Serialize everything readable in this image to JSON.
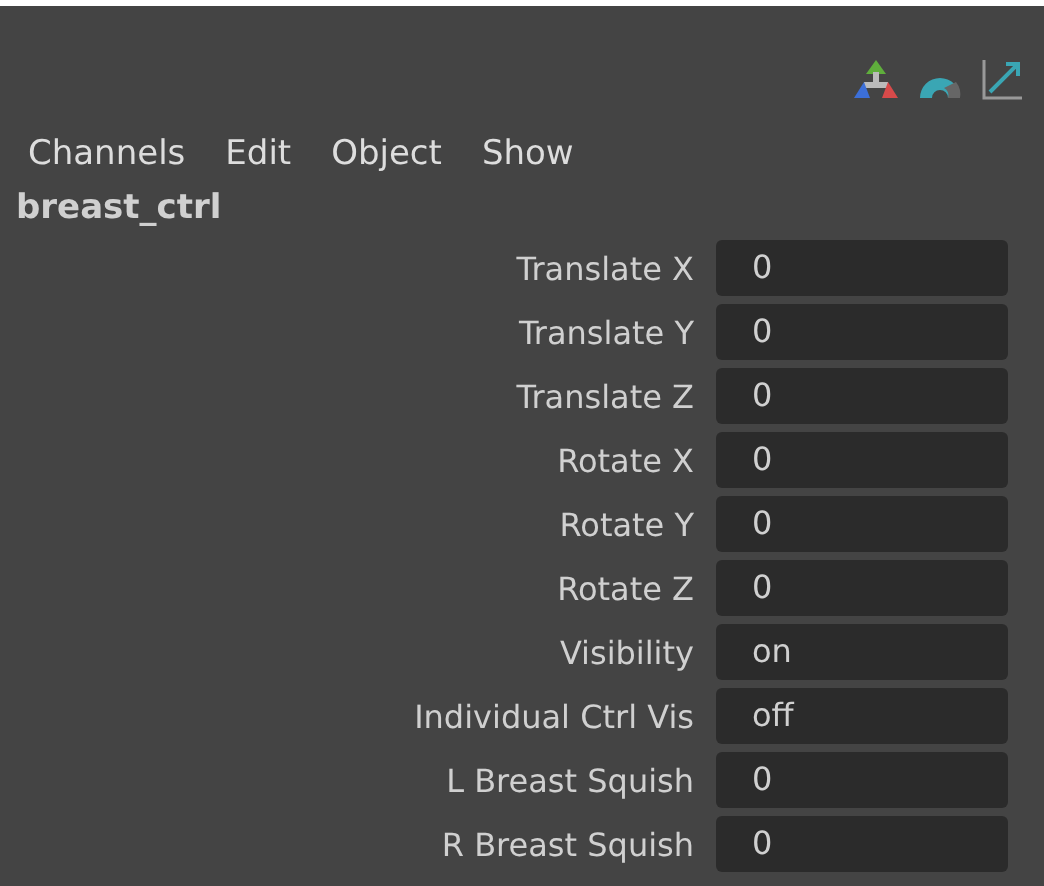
{
  "menu": [
    {
      "label": "Channels"
    },
    {
      "label": "Edit"
    },
    {
      "label": "Object"
    },
    {
      "label": "Show"
    }
  ],
  "object_name": "breast_ctrl",
  "channels": [
    {
      "name": "Translate X",
      "value": "0"
    },
    {
      "name": "Translate Y",
      "value": "0"
    },
    {
      "name": "Translate Z",
      "value": "0"
    },
    {
      "name": "Rotate X",
      "value": "0"
    },
    {
      "name": "Rotate Y",
      "value": "0"
    },
    {
      "name": "Rotate Z",
      "value": "0"
    },
    {
      "name": "Visibility",
      "value": "on"
    },
    {
      "name": "Individual Ctrl Vis",
      "value": "off"
    },
    {
      "name": "L Breast Squish",
      "value": "0"
    },
    {
      "name": "R Breast Squish",
      "value": "0"
    }
  ]
}
